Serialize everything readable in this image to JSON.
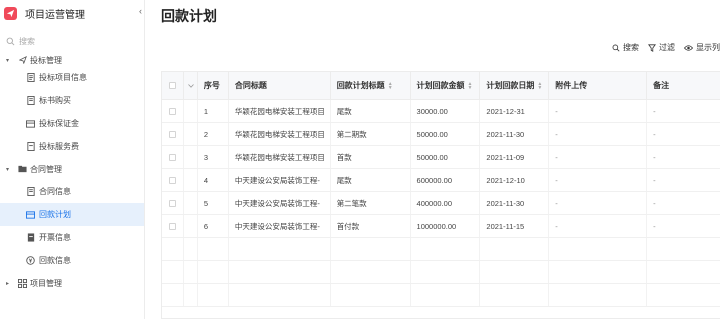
{
  "app": {
    "title": "项目运营管理",
    "collapse_glyph": "‹"
  },
  "search": {
    "placeholder": "搜索"
  },
  "sidebar": {
    "groups": [
      {
        "label": "投标管理",
        "items": [
          {
            "label": "投标项目信息"
          },
          {
            "label": "标书购买"
          },
          {
            "label": "投标保证金"
          },
          {
            "label": "投标服务费"
          }
        ]
      },
      {
        "label": "合同管理",
        "items": [
          {
            "label": "合同信息"
          },
          {
            "label": "回款计划"
          },
          {
            "label": "开票信息"
          },
          {
            "label": "回款信息"
          }
        ]
      },
      {
        "label": "项目管理"
      }
    ],
    "active": "回款计划"
  },
  "main": {
    "title": "回款计划",
    "toolbar": {
      "search": "搜索",
      "filter": "过滤",
      "display": "显示列"
    }
  },
  "table": {
    "headers": [
      "序号",
      "合同标题",
      "回款计划标题",
      "计划回款金额",
      "计划回款日期",
      "附件上传",
      "备注"
    ],
    "rows": [
      {
        "no": "1",
        "contract": "华颖花园电梯安装工程项目",
        "plan": "尾款",
        "amount": "30000.00",
        "date": "2021-12-31",
        "attach": "-",
        "note": "-"
      },
      {
        "no": "2",
        "contract": "华颖花园电梯安装工程项目",
        "plan": "第二期款",
        "amount": "50000.00",
        "date": "2021-11-30",
        "attach": "-",
        "note": "-"
      },
      {
        "no": "3",
        "contract": "华颖花园电梯安装工程项目",
        "plan": "首款",
        "amount": "50000.00",
        "date": "2021-11-09",
        "attach": "-",
        "note": "-"
      },
      {
        "no": "4",
        "contract": "中天建设公安局装饰工程-",
        "plan": "尾款",
        "amount": "600000.00",
        "date": "2021-12-10",
        "attach": "-",
        "note": "-"
      },
      {
        "no": "5",
        "contract": "中天建设公安局装饰工程-",
        "plan": "第二笔款",
        "amount": "400000.00",
        "date": "2021-11-30",
        "attach": "-",
        "note": "-"
      },
      {
        "no": "6",
        "contract": "中天建设公安局装饰工程-",
        "plan": "首付款",
        "amount": "1000000.00",
        "date": "2021-11-15",
        "attach": "-",
        "note": "-"
      }
    ]
  },
  "colors": {
    "accent": "#1a73e8",
    "brand": "#f04a5a",
    "active_bg": "#e6f0fc"
  }
}
